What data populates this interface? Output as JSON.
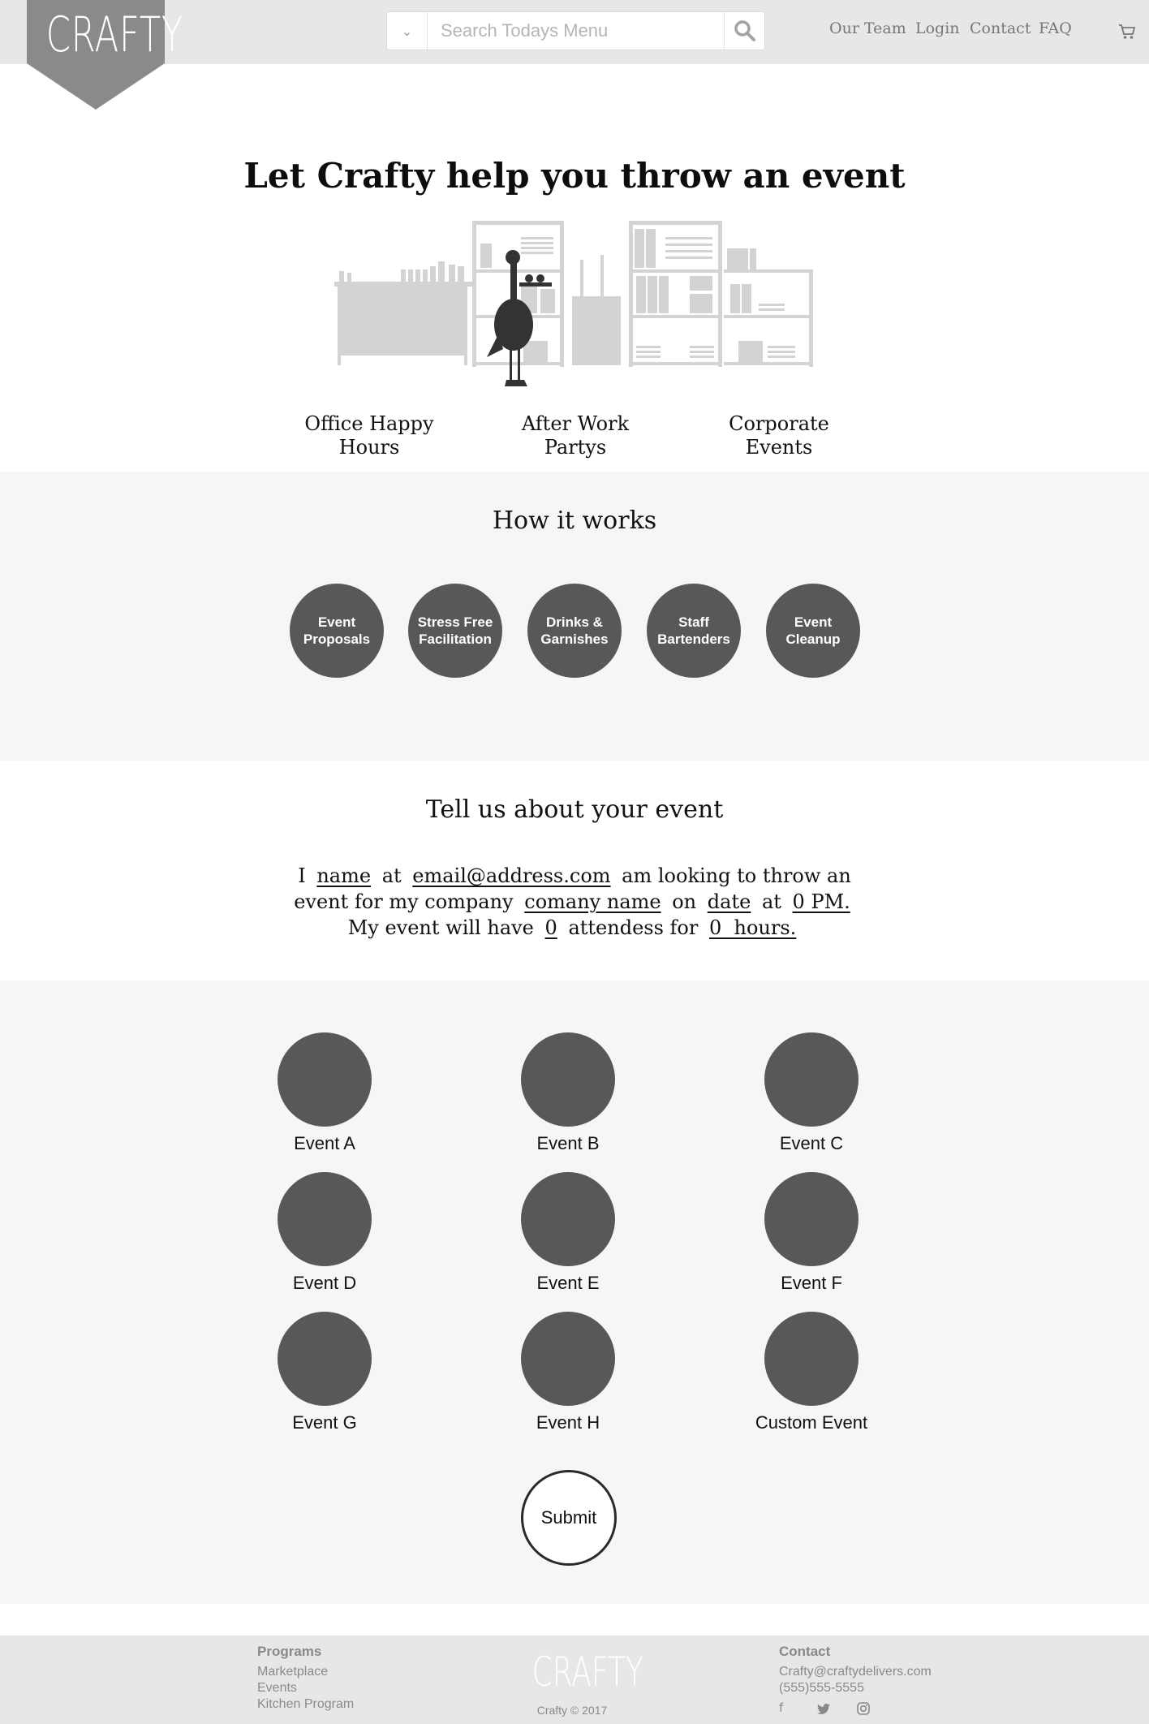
{
  "header": {
    "logo_text": "CRAFTY",
    "search_placeholder": "Search Todays Menu",
    "nav": [
      "Our Team",
      "Login",
      "Contact",
      "FAQ"
    ],
    "icons": {
      "dropdown": "chevron-down-icon",
      "search": "search-icon",
      "cart": "cart-icon"
    }
  },
  "hero": {
    "title": "Let Crafty help you throw an event",
    "categories": [
      {
        "line1": "Office Happy",
        "line2": "Hours"
      },
      {
        "line1": "After Work",
        "line2": "Partys"
      },
      {
        "line1": "Corporate",
        "line2": "Events"
      }
    ]
  },
  "how": {
    "title": "How it works",
    "steps": [
      {
        "line1": "Event",
        "line2": "Proposals"
      },
      {
        "line1": "Stress Free",
        "line2": "Facilitation"
      },
      {
        "line1": "Drinks &",
        "line2": "Garnishes"
      },
      {
        "line1": "Staff",
        "line2": "Bartenders"
      },
      {
        "line1": "Event",
        "line2": "Cleanup"
      }
    ]
  },
  "tell": {
    "title": "Tell us about your event",
    "words": {
      "i": "I",
      "at1": "at",
      "am_looking": "am looking to throw an",
      "event_for": "event for my company",
      "on": "on",
      "at2": "at",
      "my_event": "My event will have",
      "attendees_for": "attendess for"
    },
    "fields": {
      "name": "name",
      "email": "email@address.com",
      "company": "comany name",
      "date": "date",
      "time": "0 PM.",
      "attendees": "0",
      "hours": "0  hours."
    }
  },
  "events": {
    "items": [
      "Event A",
      "Event B",
      "Event C",
      "Event D",
      "Event E",
      "Event F",
      "Event G",
      "Event H",
      "Custom Event"
    ],
    "submit_label": "Submit"
  },
  "footer": {
    "programs_title": "Programs",
    "programs": [
      "Marketplace",
      "Events",
      "Kitchen Program"
    ],
    "logo_text": "CRAFTY",
    "copyright": "Crafty © 2017",
    "contact_title": "Contact",
    "email": "Crafty@craftydelivers.com",
    "phone": "(555)555-5555",
    "social": {
      "facebook": "f",
      "twitter": "twitter-icon",
      "instagram": "instagram-icon"
    }
  }
}
